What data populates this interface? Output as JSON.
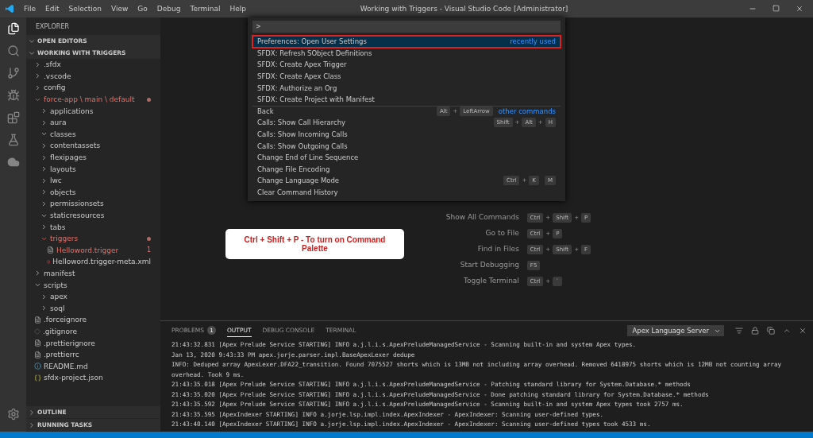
{
  "window": {
    "title": "Working with Triggers - Visual Studio Code [Administrator]"
  },
  "menu": [
    "File",
    "Edit",
    "Selection",
    "View",
    "Go",
    "Debug",
    "Terminal",
    "Help"
  ],
  "sidebar": {
    "title": "EXPLORER",
    "sections": [
      {
        "label": "OPEN EDITORS",
        "expanded": true
      },
      {
        "label": "WORKING WITH TRIGGERS",
        "expanded": true
      }
    ],
    "tree": [
      {
        "kind": "folder",
        "name": ".sfdx",
        "expanded": false,
        "modified": false
      },
      {
        "kind": "folder",
        "name": ".vscode",
        "expanded": false,
        "modified": false
      },
      {
        "kind": "folder",
        "name": "config",
        "expanded": false,
        "modified": false
      },
      {
        "kind": "folder",
        "name": "force-app \\ main \\ default",
        "expanded": true,
        "modified": true,
        "children": [
          {
            "kind": "folder",
            "name": "applications",
            "expanded": false,
            "modified": false
          },
          {
            "kind": "folder",
            "name": "aura",
            "expanded": false,
            "modified": false
          },
          {
            "kind": "folder",
            "name": "classes",
            "expanded": true,
            "modified": false
          },
          {
            "kind": "folder",
            "name": "contentassets",
            "expanded": false,
            "modified": false
          },
          {
            "kind": "folder",
            "name": "flexipages",
            "expanded": false,
            "modified": false
          },
          {
            "kind": "folder",
            "name": "layouts",
            "expanded": false,
            "modified": false
          },
          {
            "kind": "folder",
            "name": "lwc",
            "expanded": false,
            "modified": false
          },
          {
            "kind": "folder",
            "name": "objects",
            "expanded": false,
            "modified": false
          },
          {
            "kind": "folder",
            "name": "permissionsets",
            "expanded": false,
            "modified": false
          },
          {
            "kind": "folder",
            "name": "staticresources",
            "expanded": true,
            "modified": false
          },
          {
            "kind": "folder",
            "name": "tabs",
            "expanded": false,
            "modified": false
          },
          {
            "kind": "folder",
            "name": "triggers",
            "expanded": true,
            "modified": true,
            "children": [
              {
                "kind": "text-file",
                "name": "Helloword.trigger",
                "modified": true,
                "badge": "1"
              },
              {
                "kind": "xml-file",
                "name": "Helloword.trigger-meta.xml",
                "modified": false
              }
            ]
          }
        ]
      },
      {
        "kind": "folder",
        "name": "manifest",
        "expanded": false,
        "modified": false
      },
      {
        "kind": "folder",
        "name": "scripts",
        "expanded": true,
        "modified": false,
        "children": [
          {
            "kind": "folder",
            "name": "apex",
            "expanded": false,
            "modified": false
          },
          {
            "kind": "folder",
            "name": "soql",
            "expanded": false,
            "modified": false
          }
        ]
      },
      {
        "kind": "text-file",
        "name": ".forceignore",
        "modified": false
      },
      {
        "kind": "git-file",
        "name": ".gitignore",
        "modified": false
      },
      {
        "kind": "text-file",
        "name": ".prettierignore",
        "modified": false
      },
      {
        "kind": "text-file",
        "name": ".prettierrc",
        "modified": false
      },
      {
        "kind": "info-file",
        "name": "README.md",
        "modified": false
      },
      {
        "kind": "json-file",
        "name": "sfdx-project.json",
        "modified": false
      }
    ],
    "bottom_sections": [
      {
        "label": "OUTLINE",
        "expanded": false
      },
      {
        "label": "RUNNING TASKS",
        "expanded": false
      }
    ]
  },
  "key_joiner": "+",
  "palette": {
    "input": ">",
    "items": [
      {
        "label": "Preferences: Open User Settings",
        "selected": true,
        "hint": "recently used"
      },
      {
        "label": "SFDX: Refresh SObject Definitions",
        "selected": false
      },
      {
        "label": "SFDX: Create Apex Trigger",
        "selected": false
      },
      {
        "label": "SFDX: Create Apex Class",
        "selected": false
      },
      {
        "label": "SFDX: Authorize an Org",
        "selected": false
      },
      {
        "label": "SFDX: Create Project with Manifest",
        "selected": false
      },
      {
        "label": "Back",
        "selected": false,
        "separator": true,
        "keys": [
          "Alt",
          "LeftArrow"
        ],
        "hint": "other commands"
      },
      {
        "label": "Calls: Show Call Hierarchy",
        "selected": false,
        "keys": [
          "Shift",
          "Alt",
          "H"
        ]
      },
      {
        "label": "Calls: Show Incoming Calls",
        "selected": false
      },
      {
        "label": "Calls: Show Outgoing Calls",
        "selected": false
      },
      {
        "label": "Change End of Line Sequence",
        "selected": false
      },
      {
        "label": "Change File Encoding",
        "selected": false
      },
      {
        "label": "Change Language Mode",
        "selected": false,
        "keys": [
          "Ctrl",
          "K"
        ],
        "chord": [
          "M"
        ]
      },
      {
        "label": "Clear Command History",
        "selected": false
      }
    ]
  },
  "welcome": [
    {
      "label": "Show All Commands",
      "keys": [
        "Ctrl",
        "Shift",
        "P"
      ]
    },
    {
      "label": "Go to File",
      "keys": [
        "Ctrl",
        "P"
      ]
    },
    {
      "label": "Find in Files",
      "keys": [
        "Ctrl",
        "Shift",
        "F"
      ]
    },
    {
      "label": "Start Debugging",
      "keys": [
        "F5"
      ]
    },
    {
      "label": "Toggle Terminal",
      "keys": [
        "Ctrl",
        "`"
      ]
    }
  ],
  "callout": "Ctrl + Shift + P - To turn on Command Palette",
  "panel": {
    "tabs": [
      {
        "label": "PROBLEMS",
        "badge": "1",
        "selected": false
      },
      {
        "label": "OUTPUT",
        "selected": true
      },
      {
        "label": "DEBUG CONSOLE",
        "selected": false
      },
      {
        "label": "TERMINAL",
        "selected": false
      }
    ],
    "channel": "Apex Language Server",
    "lines": [
      "21:43:32.831 [Apex Prelude Service STARTING] INFO  a.j.l.i.s.ApexPreludeManagedService - Scanning built-in and system Apex types.",
      "Jan 13, 2020 9:43:33 PM apex.jorje.parser.impl.BaseApexLexer dedupe",
      "INFO: Deduped array ApexLexer.DFA22_transition. Found 7075527 shorts which is 13MB not including array overhead. Removed 6418975 shorts which is 12MB not counting array overhead. Took 9 ms.",
      "21:43:35.018 [Apex Prelude Service STARTING] INFO  a.j.l.i.s.ApexPreludeManagedService - Patching standard library for System.Database.* methods",
      "21:43:35.020 [Apex Prelude Service STARTING] INFO  a.j.l.i.s.ApexPreludeManagedService - Done patching standard library for System.Database.* methods",
      "21:43:35.592 [Apex Prelude Service STARTING] INFO  a.j.l.i.s.ApexPreludeManagedService - Scanning built-in and system Apex types took 2757 ms.",
      "21:43:35.595 [ApexIndexer STARTING] INFO  a.jorje.lsp.impl.index.ApexIndexer - ApexIndexer: Scanning user-defined types.",
      "21:43:40.140 [ApexIndexer STARTING] INFO  a.jorje.lsp.impl.index.ApexIndexer - ApexIndexer: Scanning user-defined types took 4533 ms."
    ]
  }
}
